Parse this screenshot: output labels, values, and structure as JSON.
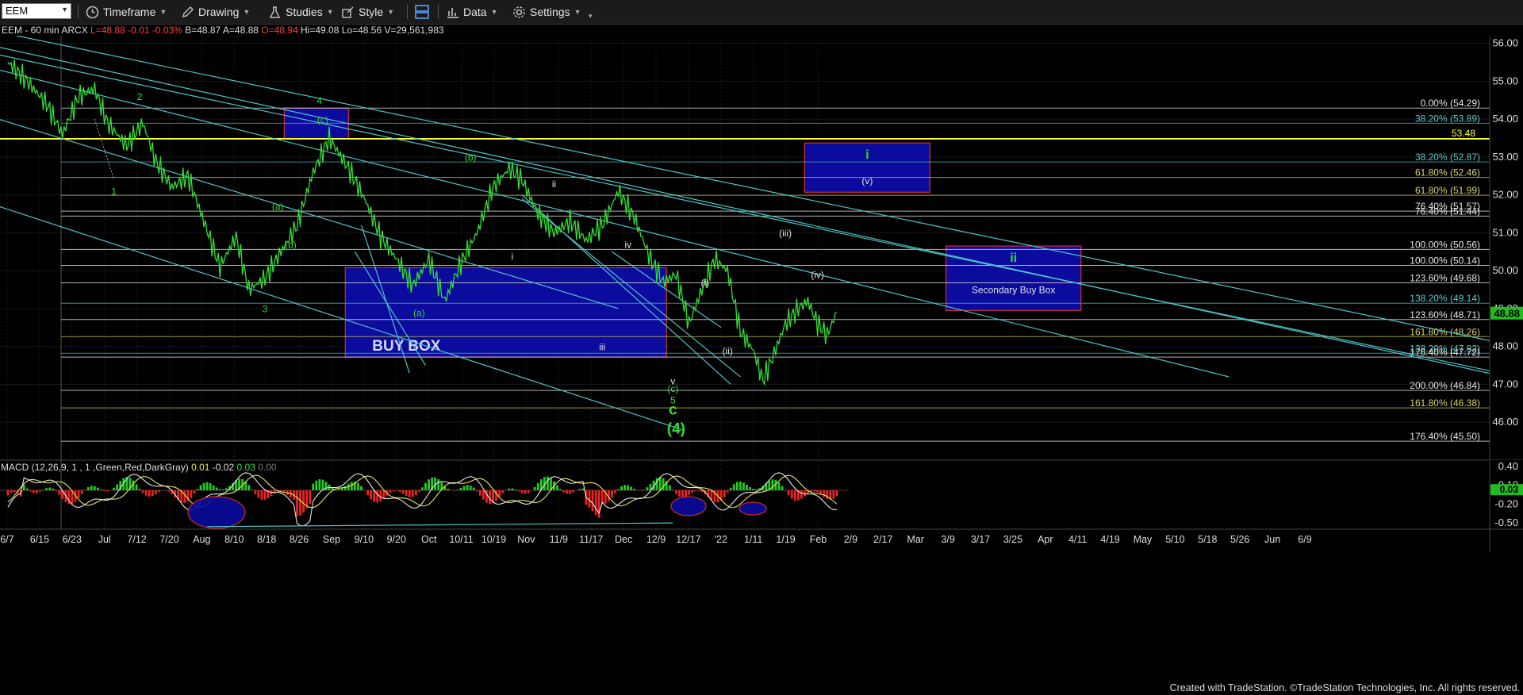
{
  "toolbar": {
    "symbol": "EEM",
    "timeframe": "Timeframe",
    "drawing": "Drawing",
    "studies": "Studies",
    "style": "Style",
    "data": "Data",
    "settings": "Settings"
  },
  "header": {
    "symbol_info": "EEM - 60 min  ARCX",
    "last": "L=48.88",
    "change": "-0.01",
    "change_pct": "-0.03%",
    "bid": "B=48.87",
    "ask": "A=48.88",
    "open": "O=48.94",
    "high": "Hi=49.08",
    "low": "Lo=48.56",
    "volume": "V=29,561,983"
  },
  "footer": "Created with TradeStation. ©TradeStation Technologies, Inc. All rights reserved.",
  "colors": {
    "price": "#33dd33",
    "trendline": "#4fc3c8",
    "box_fill": "#0b0b9e",
    "box_border": "#d03030",
    "level": "#ffff33",
    "macd_line": "#e8e8e8",
    "signal_line": "#e8e854",
    "hist_pos": "#22cc22",
    "hist_neg": "#ee2222"
  },
  "chart_data": {
    "type": "line",
    "title": "EEM - 60 min",
    "ylim": [
      45.0,
      56.2
    ],
    "y_ticks": [
      46.0,
      47.0,
      48.0,
      49.0,
      50.0,
      51.0,
      52.0,
      53.0,
      54.0,
      55.0,
      56.0
    ],
    "x_ticks": [
      "6/7",
      "6/15",
      "6/23",
      "Jul",
      "7/12",
      "7/20",
      "Aug",
      "8/10",
      "8/18",
      "8/26",
      "Sep",
      "9/10",
      "9/20",
      "Oct",
      "10/11",
      "10/19",
      "Nov",
      "11/9",
      "11/17",
      "Dec",
      "12/9",
      "12/17",
      "'22",
      "1/11",
      "1/19",
      "Feb",
      "2/9",
      "2/17",
      "Mar",
      "3/9",
      "3/17",
      "3/25",
      "Apr",
      "4/11",
      "4/19",
      "May",
      "5/10",
      "5/18",
      "5/26",
      "Jun",
      "6/9"
    ],
    "last_price": "48.88",
    "price_series_approx": [
      [
        0,
        55.5
      ],
      [
        6,
        55.0
      ],
      [
        12,
        54.4
      ],
      [
        17,
        53.6
      ],
      [
        22,
        54.6
      ],
      [
        27,
        54.8
      ],
      [
        31,
        53.9
      ],
      [
        37,
        53.3
      ],
      [
        42,
        53.9
      ],
      [
        46,
        52.9
      ],
      [
        51,
        52.2
      ],
      [
        56,
        52.5
      ],
      [
        61,
        51.3
      ],
      [
        66,
        50.1
      ],
      [
        71,
        50.9
      ],
      [
        75,
        49.5
      ],
      [
        80,
        49.8
      ],
      [
        85,
        50.5
      ],
      [
        90,
        51.2
      ],
      [
        95,
        52.6
      ],
      [
        100,
        53.5
      ],
      [
        106,
        52.7
      ],
      [
        111,
        51.9
      ],
      [
        116,
        50.9
      ],
      [
        121,
        50.3
      ],
      [
        126,
        49.6
      ],
      [
        131,
        50.3
      ],
      [
        136,
        49.2
      ],
      [
        141,
        50.2
      ],
      [
        146,
        51.0
      ],
      [
        151,
        52.2
      ],
      [
        156,
        52.7
      ],
      [
        160,
        52.4
      ],
      [
        165,
        51.5
      ],
      [
        170,
        51.0
      ],
      [
        175,
        51.3
      ],
      [
        180,
        50.8
      ],
      [
        185,
        51.2
      ],
      [
        190,
        52.1
      ],
      [
        195,
        51.4
      ],
      [
        200,
        50.3
      ],
      [
        204,
        49.7
      ],
      [
        208,
        49.9
      ],
      [
        212,
        48.6
      ],
      [
        216,
        49.5
      ],
      [
        220,
        50.3
      ],
      [
        224,
        50.0
      ],
      [
        228,
        48.4
      ],
      [
        232,
        47.9
      ],
      [
        235,
        47.1
      ],
      [
        238,
        47.7
      ],
      [
        242,
        48.6
      ],
      [
        246,
        49.0
      ],
      [
        249,
        49.2
      ],
      [
        252,
        48.6
      ],
      [
        255,
        48.3
      ],
      [
        258,
        48.9
      ]
    ],
    "fib_levels": [
      {
        "label": "0.00% (54.29)",
        "value": 54.29,
        "color": "#cfcfcf"
      },
      {
        "label": "38.20% (53.89)",
        "value": 53.89,
        "color": "#3fa3a8"
      },
      {
        "label": "38.20% (52.87)",
        "value": 52.87,
        "color": "#3fa3a8"
      },
      {
        "label": "61.80% (52.46)",
        "value": 52.46,
        "color": "#b3b355"
      },
      {
        "label": "61.80% (51.99)",
        "value": 51.99,
        "color": "#b3b355"
      },
      {
        "label": "76.40% (51.57)",
        "value": 51.57,
        "color": "#cfcfcf"
      },
      {
        "label": "76.40% (51.44)",
        "value": 51.44,
        "color": "#cfcfcf"
      },
      {
        "label": "100.00% (50.56)",
        "value": 50.56,
        "color": "#cfcfcf"
      },
      {
        "label": "100.00% (50.14)",
        "value": 50.14,
        "color": "#cfcfcf"
      },
      {
        "label": "123.60% (49.68)",
        "value": 49.68,
        "color": "#cfcfcf"
      },
      {
        "label": "138.20% (49.14)",
        "value": 49.14,
        "color": "#3fa3a8"
      },
      {
        "label": "123.60% (48.71)",
        "value": 48.71,
        "color": "#cfcfcf"
      },
      {
        "label": "161.80% (48.26)",
        "value": 48.26,
        "color": "#b3b355"
      },
      {
        "label": "138.20% (47.82)",
        "value": 47.82,
        "color": "#3fa3a8"
      },
      {
        "label": "176.40% (47.72)",
        "value": 47.72,
        "color": "#cfcfcf"
      },
      {
        "label": "200.00% (46.84)",
        "value": 46.84,
        "color": "#cfcfcf"
      },
      {
        "label": "161.80% (46.38)",
        "value": 46.38,
        "color": "#b3b355"
      },
      {
        "label": "176.40% (45.50)",
        "value": 45.5,
        "color": "#cfcfcf"
      }
    ],
    "horizontal_level": {
      "label": "53.48",
      "value": 53.48
    },
    "boxes": [
      {
        "label": "BUY BOX",
        "bar_start": 105,
        "bar_end": 205,
        "top": 50.08,
        "bottom": 47.72
      },
      {
        "label": "",
        "bar_start": 86,
        "bar_end": 106,
        "top": 54.29,
        "bottom": 53.48
      },
      {
        "label": "i",
        "sublabel": "(v)",
        "bar_start": 248,
        "bar_end": 287,
        "top": 53.37,
        "bottom": 52.07
      },
      {
        "label": "ii",
        "sublabel": "Secondary Buy Box",
        "bar_start": 292,
        "bar_end": 334,
        "top": 50.65,
        "bottom": 48.95
      }
    ],
    "wave_labels": [
      {
        "text": "1",
        "bar": 33,
        "price": 52.0,
        "color": "#33dd33"
      },
      {
        "text": "2",
        "bar": 41,
        "price": 54.5,
        "color": "#33dd33"
      },
      {
        "text": "3",
        "bar": 80,
        "price": 48.9,
        "color": "#33dd33"
      },
      {
        "text": "4",
        "bar": 97,
        "price": 54.4,
        "color": "#33dd33"
      },
      {
        "text": "(c)",
        "bar": 98,
        "price": 53.9,
        "color": "#33dd33"
      },
      {
        "text": "(a)",
        "bar": 84,
        "price": 51.6,
        "color": "#33dd33"
      },
      {
        "text": "(b)",
        "bar": 88,
        "price": 50.6,
        "color": "#33dd33"
      },
      {
        "text": "(b)",
        "bar": 144,
        "price": 52.9,
        "color": "#33dd33"
      },
      {
        "text": "(a)",
        "bar": 128,
        "price": 48.8,
        "color": "#33dd33"
      },
      {
        "text": "i",
        "bar": 157,
        "price": 50.3,
        "color": "#e0e0e0"
      },
      {
        "text": "ii",
        "bar": 170,
        "price": 52.2,
        "color": "#e0e0e0"
      },
      {
        "text": "iii",
        "bar": 185,
        "price": 47.9,
        "color": "#e0e0e0"
      },
      {
        "text": "iv",
        "bar": 193,
        "price": 50.6,
        "color": "#e0e0e0"
      },
      {
        "text": "v",
        "bar": 207,
        "price": 47.0,
        "color": "#e0e0e0"
      },
      {
        "text": "(c)",
        "bar": 207,
        "price": 46.8,
        "color": "#33dd33"
      },
      {
        "text": "5",
        "bar": 207,
        "price": 46.5,
        "color": "#33dd33"
      },
      {
        "text": "c",
        "bar": 207,
        "price": 46.2,
        "color": "#33dd33"
      },
      {
        "text": "(4)",
        "bar": 208,
        "price": 45.7,
        "color": "#33dd33"
      },
      {
        "text": "(i)",
        "bar": 217,
        "price": 49.6,
        "color": "#e0e0e0"
      },
      {
        "text": "(ii)",
        "bar": 224,
        "price": 47.8,
        "color": "#e0e0e0"
      },
      {
        "text": "(iii)",
        "bar": 242,
        "price": 50.9,
        "color": "#e0e0e0"
      },
      {
        "text": "(iv)",
        "bar": 252,
        "price": 49.8,
        "color": "#e0e0e0"
      }
    ],
    "macd": {
      "label": "MACD (12,26,9, 1 , 1 ,Green,Red,DarkGray)",
      "values": [
        "0.01",
        "-0.02",
        "0.03",
        "0.00"
      ],
      "value_colors": [
        "#e6e64d",
        "#e0e0e0",
        "#33dd33",
        "#777777"
      ],
      "ylim": [
        -0.6,
        0.5
      ],
      "y_ticks": [
        0.4,
        0.1,
        -0.2,
        -0.5
      ],
      "last": "0.03"
    }
  }
}
